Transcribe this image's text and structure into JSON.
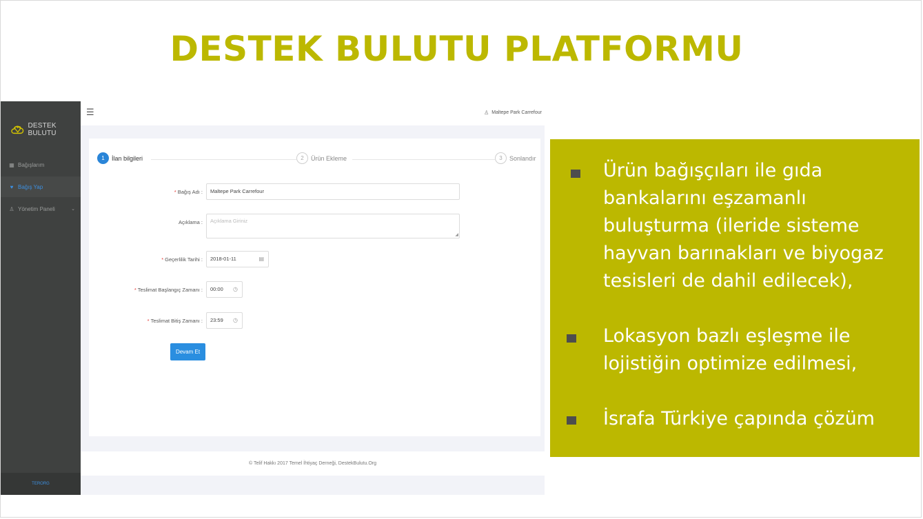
{
  "slide": {
    "title": "DESTEK BULUTU PLATFORMU"
  },
  "app": {
    "brand": {
      "name": "DESTEK BULUTU",
      "logo_icon": "cloud-heart-logo-icon"
    },
    "sidebar": {
      "items": [
        {
          "label": "Bağışlarım",
          "icon": "grid-icon",
          "active": false
        },
        {
          "label": "Bağış Yap",
          "icon": "heart-icon",
          "active": true
        },
        {
          "label": "Yönetim Paneli",
          "icon": "user-icon",
          "active": false,
          "has_caret": true
        }
      ],
      "footer": "TERORG"
    },
    "topbar": {
      "menu_icon": "menu-toggle-icon",
      "user_name": "Maltepe Park Carrefour"
    },
    "stepper": {
      "steps": [
        {
          "number": "1",
          "label": "İlan bilgileri",
          "active": true
        },
        {
          "number": "2",
          "label": "Ürün Ekleme",
          "active": false
        },
        {
          "number": "3",
          "label": "Sonlandır",
          "active": false
        }
      ]
    },
    "form": {
      "donation_name": {
        "label": "Bağış Adı :",
        "value": "Maltepe Park Carrefour",
        "required": true
      },
      "description": {
        "label": "Açıklama :",
        "placeholder": "Açıklama Giriniz",
        "required": false
      },
      "expiry_date": {
        "label": "Geçerlilik Tarihi :",
        "value": "2018-01-11",
        "required": true
      },
      "delivery_start": {
        "label": "Teslimat Başlangıç Zamanı :",
        "value": "00:00",
        "required": true
      },
      "delivery_end": {
        "label": "Teslimat Bitiş Zamanı :",
        "value": "23:59",
        "required": true
      },
      "submit_label": "Devam Et"
    },
    "footer": "© Telif Hakkı 2017 Temel İhtiyaç Derneği, DestekBulutu.Org",
    "colors": {
      "primary": "#2a8ee0",
      "sidebar": "#3f4140",
      "required": "#e53935"
    }
  },
  "info_panel": {
    "background": "#bcb800",
    "bullets": [
      "Ürün bağışçıları ile gıda bankalarını eşzamanlı buluşturma (ileride sisteme hayvan barınakları ve biyogaz tesisleri de dahil edilecek),",
      "Lokasyon bazlı eşleşme ile lojistiğin optimize edilmesi,",
      "İsrafa Türkiye çapında çözüm"
    ]
  }
}
